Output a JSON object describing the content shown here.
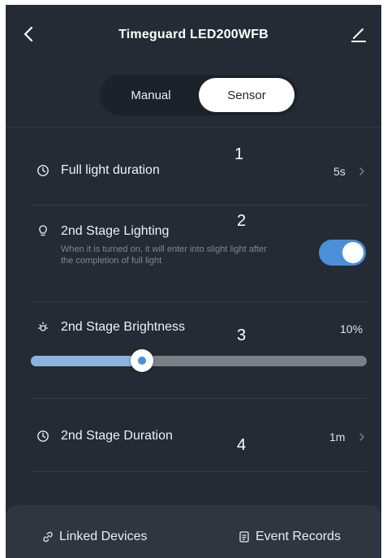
{
  "header": {
    "title": "Timeguard LED200WFB",
    "back_icon": "chevron-left-icon",
    "edit_icon": "pencil-icon"
  },
  "mode_tabs": [
    {
      "label": "Manual",
      "active": false
    },
    {
      "label": "Sensor",
      "active": true
    }
  ],
  "settings": {
    "full_light_duration": {
      "label": "Full light duration",
      "value": "5s",
      "badge": "1",
      "icon": "clock-icon"
    },
    "second_stage_lighting": {
      "label": "2nd Stage Lighting",
      "description": "When it is turned on, it will enter into slight light after the completion of full light",
      "enabled": true,
      "badge": "2",
      "icon": "bulb-icon"
    },
    "second_stage_brightness": {
      "label": "2nd Stage Brightness",
      "value": "10%",
      "level": 0.33,
      "badge": "3",
      "icon": "sun-icon"
    },
    "second_stage_duration": {
      "label": "2nd Stage Duration",
      "value": "1m",
      "badge": "4",
      "icon": "clock-icon"
    }
  },
  "bottom_bar": {
    "linked_devices": "Linked Devices",
    "event_records": "Event Records"
  },
  "colors": {
    "background": "#242b34",
    "accent": "#4a8fd8",
    "bottom_bar": "#2f3640"
  }
}
